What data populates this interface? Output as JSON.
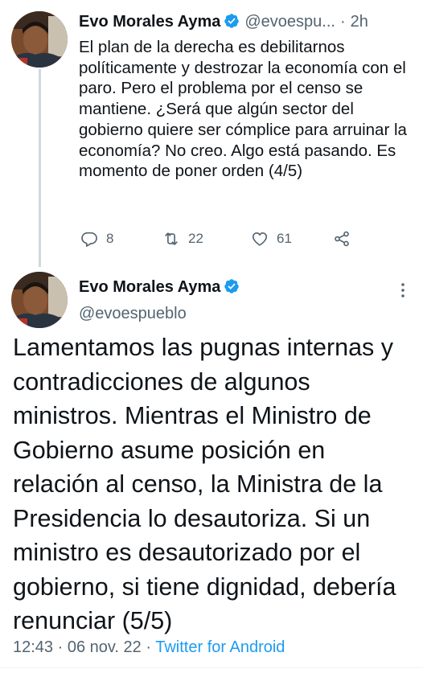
{
  "colors": {
    "accent": "#1d9bf0",
    "secondary_text": "#536471",
    "primary_text": "#0f1419"
  },
  "tweet1": {
    "author_name": "Evo Morales Ayma",
    "handle": "@evoespu...",
    "separator": "·",
    "time": "2h",
    "text": "El plan de la derecha es debilitarnos políticamente y destrozar la economía con el paro. Pero el problema por el censo se mantiene. ¿Será que algún sector del gobierno quiere ser cómplice para arruinar la economía? No  creo. Algo está pasando. Es momento de poner orden (4/5)",
    "replies": "8",
    "retweets": "22",
    "likes": "61",
    "icons": [
      "reply-icon",
      "retweet-icon",
      "like-icon",
      "share-icon"
    ]
  },
  "tweet2": {
    "author_name": "Evo Morales Ayma",
    "handle": "@evoespueblo",
    "text": "Lamentamos las pugnas internas y contradicciones de algunos ministros. Mientras el Ministro de Gobierno asume posición en relación al censo, la Ministra de la Presidencia lo desautoriza. Si un ministro es desautorizado por el gobierno, si tiene dignidad, debería renunciar (5/5)",
    "time": "12:43",
    "separator1": "·",
    "date": "06 nov. 22",
    "separator2": "·",
    "source": "Twitter for Android"
  }
}
